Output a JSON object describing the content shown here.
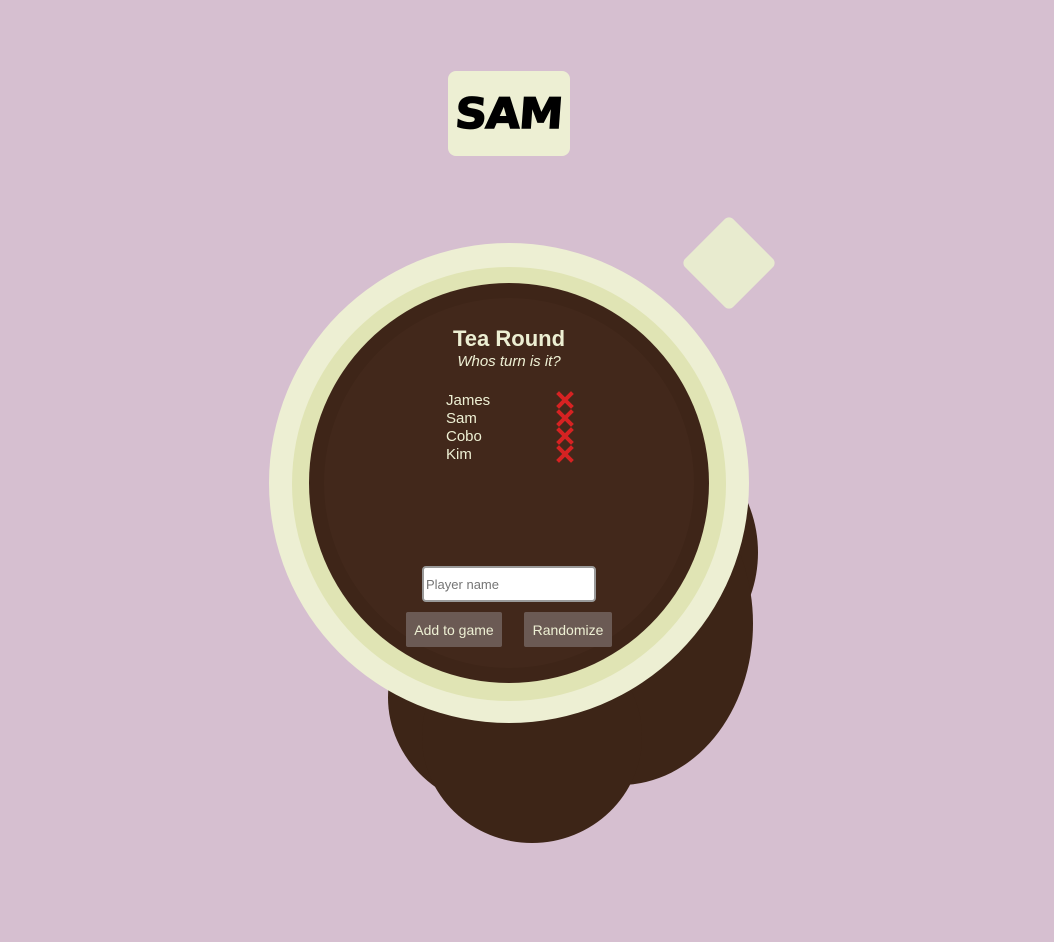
{
  "name_tag": {
    "label": "SAM"
  },
  "game": {
    "title": "Tea Round",
    "subtitle": "Whos turn is it?"
  },
  "players": [
    {
      "name": "James"
    },
    {
      "name": "Sam"
    },
    {
      "name": "Cobo"
    },
    {
      "name": "Kim"
    }
  ],
  "form": {
    "placeholder": "Player name",
    "value": "",
    "add_label": "Add to game",
    "randomize_label": "Randomize"
  },
  "colors": {
    "background": "#d6bfd0",
    "cup": "#edefd3",
    "tea": "#3e2518",
    "remove_icon": "#d62222",
    "button": "#6b5a54"
  },
  "icons": {
    "remove": "close-icon"
  }
}
